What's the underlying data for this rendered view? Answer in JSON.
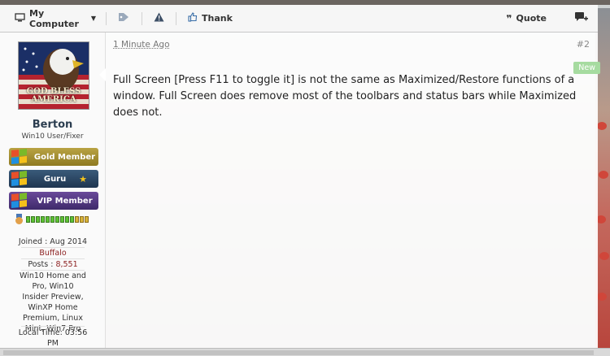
{
  "toolbar": {
    "my_computer_label": "My Computer",
    "thank_label": "Thank",
    "quote_label": "Quote"
  },
  "post": {
    "date": "1 Minute Ago",
    "number": "#2",
    "new_badge": "New",
    "message": "Full Screen [Press F11 to toggle it] is not the same as Maximized/Restore functions of a window. Full Screen does remove most of the toolbars and status bars while Maximized does not."
  },
  "user": {
    "avatar_caption": "GOD BLESS AMERICA",
    "name": "Berton",
    "title": "Win10 User/Fixer",
    "ranks": [
      {
        "label": "Gold Member"
      },
      {
        "label": "Guru"
      },
      {
        "label": "VIP Member"
      }
    ],
    "joined": "Joined : Aug 2014",
    "location": "Buffalo",
    "posts_label": "Posts :",
    "posts_value": "8,551",
    "os": "Win10 Home and Pro, Win10 Insider Preview, WinXP Home Premium, Linux Mint, Win7 Pro",
    "local_time": "Local Time: 03:56 PM"
  },
  "colors": {
    "gold": "#a8922f",
    "guru": "#2e4a68",
    "vip": "#55387f",
    "accent_red": "#8b1e1e"
  },
  "icons": [
    "computer-icon",
    "tag-icon",
    "warning-icon",
    "thumbs-up-icon",
    "quote-icon",
    "reply-plus-icon",
    "star-icon",
    "medal-icon"
  ]
}
